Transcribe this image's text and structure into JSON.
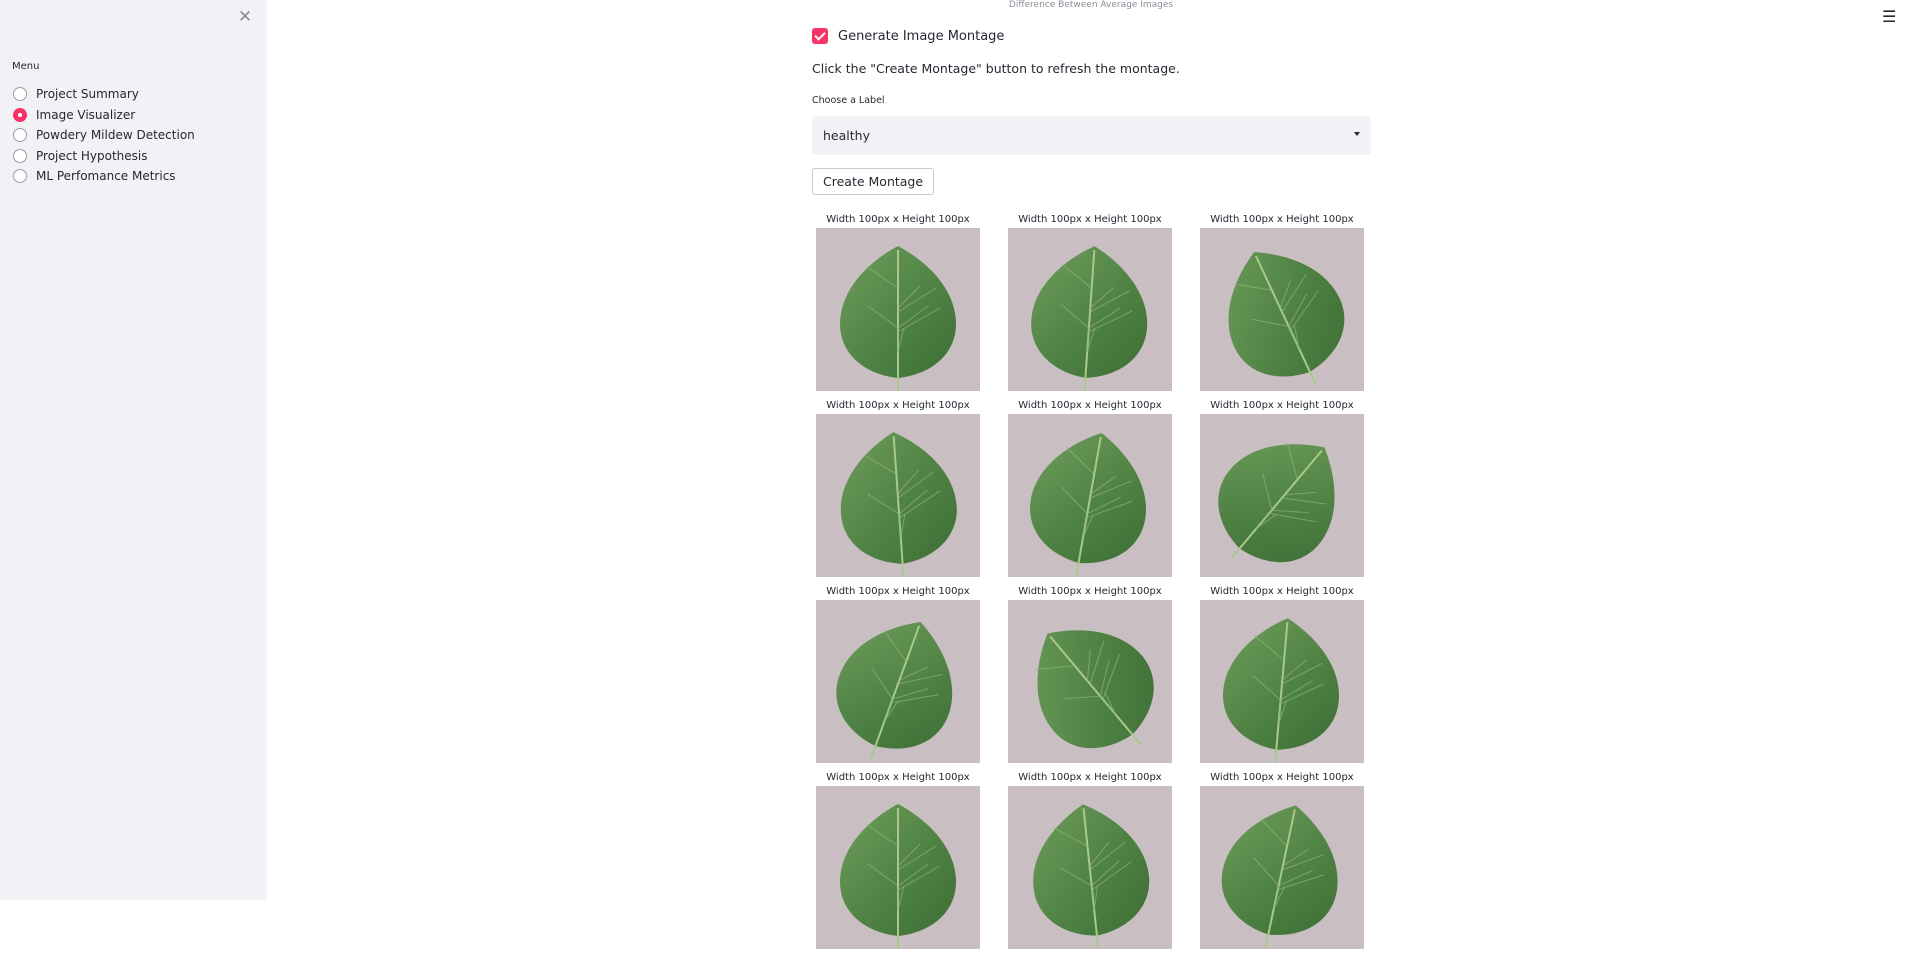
{
  "app": {
    "top_caption": "Difference Between Average Images"
  },
  "sidebar": {
    "close_symbol": "✕",
    "menu_title": "Menu",
    "items": [
      {
        "label": "Project Summary",
        "selected": false
      },
      {
        "label": "Image Visualizer",
        "selected": true
      },
      {
        "label": "Powdery Mildew Detection",
        "selected": false
      },
      {
        "label": "Project Hypothesis",
        "selected": false
      },
      {
        "label": "ML Perfomance Metrics",
        "selected": false
      }
    ]
  },
  "header": {
    "menu_icon_symbol": "☰"
  },
  "main": {
    "checkbox_label": "Generate Image Montage",
    "checkbox_checked": true,
    "info_text": "Click the \"Create Montage\" button to refresh the montage.",
    "select_label": "Choose a Label",
    "select_value": "healthy",
    "button_label": "Create Montage",
    "image_captions": [
      "Width 100px x Height 100px",
      "Width 100px x Height 100px",
      "Width 100px x Height 100px",
      "Width 100px x Height 100px",
      "Width 100px x Height 100px",
      "Width 100px x Height 100px",
      "Width 100px x Height 100px",
      "Width 100px x Height 100px",
      "Width 100px x Height 100px",
      "Width 100px x Height 100px",
      "Width 100px x Height 100px",
      "Width 100px x Height 100px"
    ]
  },
  "colors": {
    "accent": "#f63366",
    "sidebar_bg": "#f0f2f6",
    "text": "#262730",
    "leaf_background": "#c9bfc2",
    "leaf_dark": "#3d6e35",
    "leaf_light": "#6f9e5c"
  }
}
